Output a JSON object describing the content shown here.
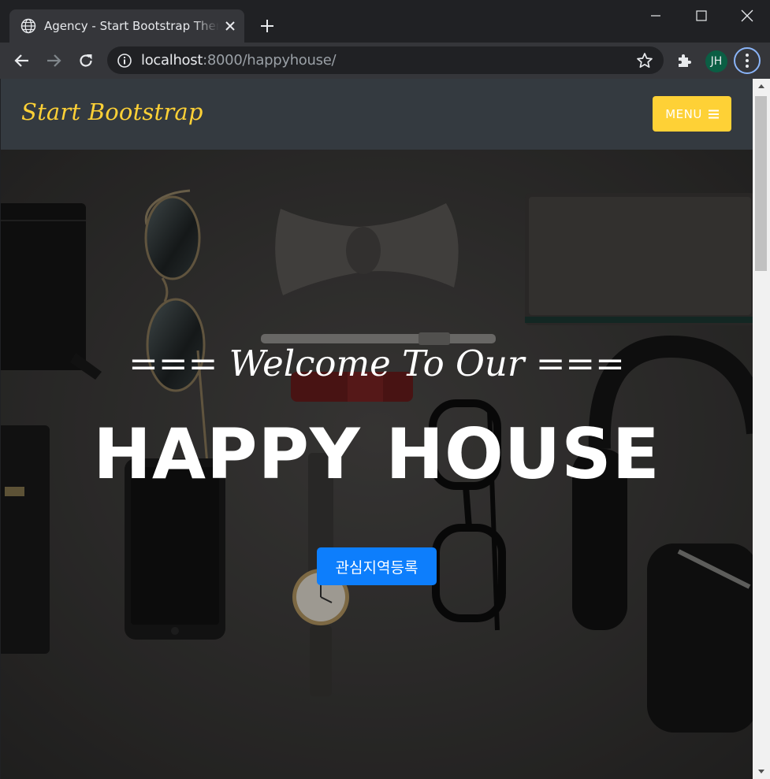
{
  "browser": {
    "tab_title": "Agency - Start Bootstrap Theme",
    "url_host": "localhost",
    "url_rest": ":8000/happyhouse/",
    "profile_initials": "JH"
  },
  "navbar": {
    "brand": "Start Bootstrap",
    "menu_label": "MENU"
  },
  "hero": {
    "subheading": "=== Welcome To Our ===",
    "heading": "HAPPY HOUSE",
    "button_label": "관심지역등록"
  },
  "colors": {
    "brand_yellow": "#fed136",
    "cta_blue": "#0d7efc",
    "navbar_bg": "#343a40"
  }
}
